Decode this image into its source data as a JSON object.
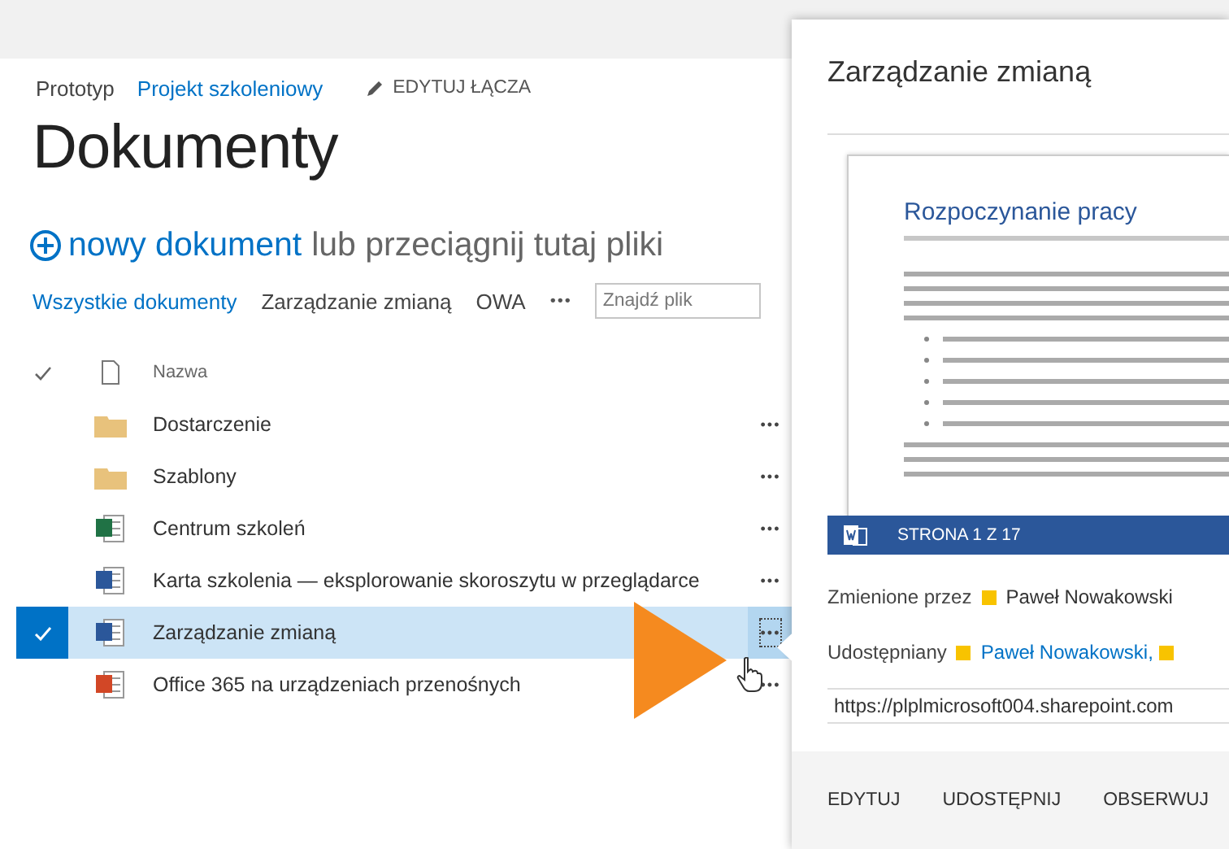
{
  "breadcrumb": {
    "site": "Prototyp",
    "project": "Projekt szkoleniowy",
    "edit_links": "EDYTUJ ŁĄCZA"
  },
  "title": "Dokumenty",
  "new_document": {
    "action": "nowy dokument",
    "rest": "lub przeciągnij tutaj pliki"
  },
  "views": [
    {
      "label": "Wszystkie dokumenty",
      "selected": true
    },
    {
      "label": "Zarządzanie zmianą",
      "selected": false
    },
    {
      "label": "OWA",
      "selected": false
    }
  ],
  "more_views": "•••",
  "search": {
    "placeholder": "Znajdź plik"
  },
  "list": {
    "column": "Nazwa",
    "rows": [
      {
        "kind": "folder",
        "name": "Dostarczenie",
        "selected": false,
        "menu": "•••"
      },
      {
        "kind": "folder",
        "name": "Szablony",
        "selected": false,
        "menu": "•••"
      },
      {
        "kind": "excel",
        "name": "Centrum szkoleń",
        "selected": false,
        "menu": "•••"
      },
      {
        "kind": "word",
        "name": "Karta szkolenia — eksplorowanie skoroszytu w przeglądarce",
        "selected": false,
        "menu": "•••"
      },
      {
        "kind": "word",
        "name": "Zarządzanie zmianą",
        "selected": true,
        "menu": "•••"
      },
      {
        "kind": "powerpoint",
        "name": "Office 365 na urządzeniach przenośnych",
        "selected": false,
        "menu": "•••"
      }
    ]
  },
  "callout": {
    "title": "Zarządzanie zmianą",
    "preview": {
      "heading": "Rozpoczynanie pracy",
      "page": "STRONA 1 Z 17"
    },
    "fields": [
      {
        "label": "Zmienione przez",
        "value": "Paweł Nowakowski",
        "link": false
      },
      {
        "label": "Udostępniany",
        "value": "Paweł Nowakowski,",
        "link": true
      }
    ],
    "url": "https://plplmicrosoft004.sharepoint.com",
    "actions": [
      "EDYTUJ",
      "UDOSTĘPNIJ",
      "OBSERWUJ"
    ]
  }
}
